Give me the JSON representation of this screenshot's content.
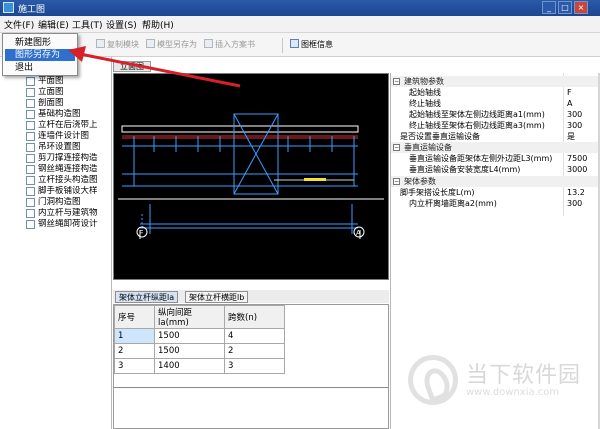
{
  "window": {
    "title": "施工图",
    "controls": [
      "_",
      "□",
      "×"
    ]
  },
  "menu": {
    "items": [
      "文件(F)",
      "编辑(E)",
      "工具(T)",
      "设置(S)",
      "帮助(H)"
    ]
  },
  "file_menu": {
    "items": [
      "新建图形",
      "图形另存为",
      "退出"
    ],
    "selected_index": 1
  },
  "toolbar": {
    "buttons": [
      "复制模块",
      "模型另存为",
      "插入方案书",
      "图框信息"
    ],
    "enabled": [
      false,
      false,
      false,
      true
    ]
  },
  "tree": {
    "items": [
      "平面图",
      "立面图",
      "剖面图",
      "基础构造图",
      "立杆在后浇带上",
      "连墙件设计图",
      "吊环设置图",
      "剪刀撑连接构造",
      "钢丝绳连接构造",
      "立杆接头构造图",
      "脚手板铺设大样",
      "门洞构造图",
      "内立杆与建筑物",
      "钢丝绳卸荷设计"
    ]
  },
  "drawing": {
    "tab_label": "立面图",
    "axis_labels": [
      "F",
      "A"
    ]
  },
  "bottom_tabs": {
    "items": [
      "架体立杆纵距la",
      "架体立杆横距lb"
    ],
    "active_index": 0
  },
  "grid": {
    "headers": [
      "序号",
      "纵向间距la(mm)",
      "跨数(n)"
    ],
    "rows": [
      [
        "1",
        "1500",
        "4"
      ],
      [
        "2",
        "1500",
        "2"
      ],
      [
        "3",
        "1400",
        "3"
      ]
    ]
  },
  "properties": {
    "categories": [
      {
        "name": "建筑物参数",
        "rows": [
          {
            "key": "起始轴线",
            "value": "F",
            "indent": true
          },
          {
            "key": "终止轴线",
            "value": "A",
            "indent": true
          },
          {
            "key": "起始轴线至架体左侧边线距离a1(mm)",
            "value": "300",
            "indent": true
          },
          {
            "key": "终止轴线至架体右侧边线距离a3(mm)",
            "value": "300",
            "indent": true
          },
          {
            "key": "是否设置垂直运输设备",
            "value": "是",
            "indent": false
          }
        ]
      },
      {
        "name": "垂直运输设备",
        "rows": [
          {
            "key": "垂直运输设备距架体左侧外边距L3(mm)",
            "value": "7500",
            "indent": true
          },
          {
            "key": "垂直运输设备安装宽度L4(mm)",
            "value": "3000",
            "indent": true
          }
        ]
      },
      {
        "name": "架体参数",
        "rows": [
          {
            "key": "脚手架搭设长度L(m)",
            "value": "13.2",
            "indent": false
          },
          {
            "key": "内立杆离墙距离a2(mm)",
            "value": "300",
            "indent": true
          }
        ]
      }
    ]
  },
  "watermark": {
    "title": "当下软件园",
    "url": "www.downxia.com"
  },
  "colors": {
    "menu_highlight": "#2f6fcf",
    "arrow": "#d6202a",
    "drawing_bg": "#000000"
  }
}
